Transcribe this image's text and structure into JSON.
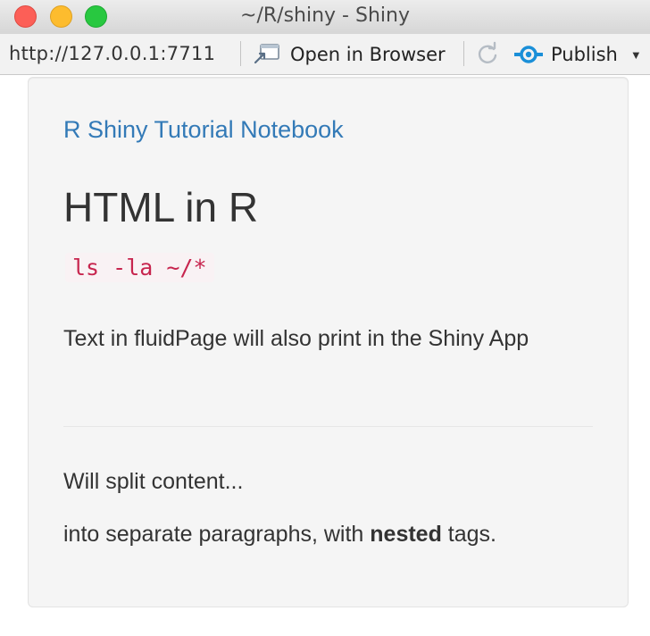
{
  "window": {
    "title": "~/R/shiny - Shiny"
  },
  "toolbar": {
    "url": "http://127.0.0.1:7711",
    "open_in_browser_label": "Open in Browser",
    "publish_label": "Publish",
    "accent_color": "#1a8fd8"
  },
  "page": {
    "brand_link": "R Shiny Tutorial Notebook",
    "heading": "HTML in R",
    "code": "ls -la ~/*",
    "paragraph_1": "Text in fluidPage will also print in the Shiny App",
    "paragraph_2": "Will split content...",
    "paragraph_3": {
      "before": "into separate paragraphs, with ",
      "bold": "nested",
      "after": " tags."
    },
    "link_color": "#337ab7",
    "code_color": "#c7254e"
  }
}
